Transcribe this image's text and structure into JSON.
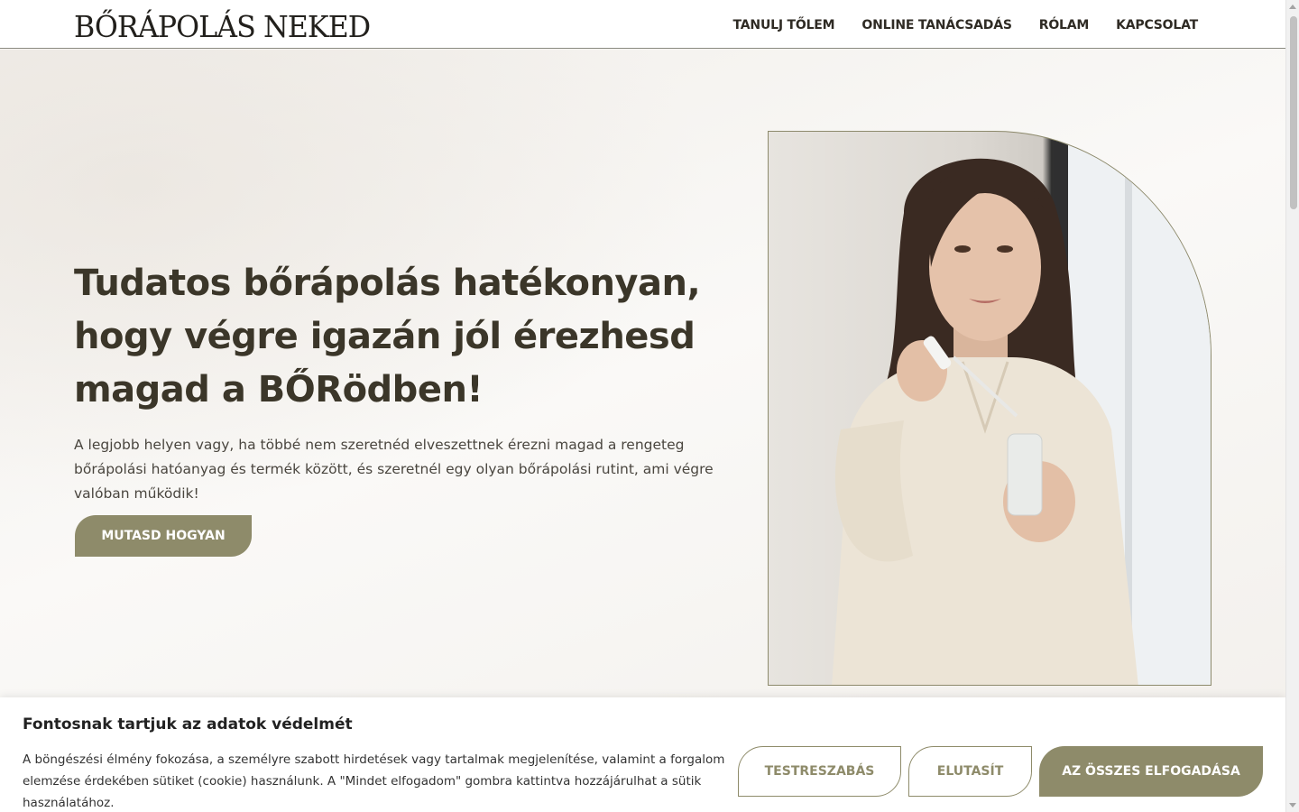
{
  "header": {
    "logo": "BŐRÁPOLÁS NEKED",
    "nav": [
      {
        "label": "TANULJ TŐLEM"
      },
      {
        "label": "ONLINE TANÁCSADÁS"
      },
      {
        "label": "RÓLAM"
      },
      {
        "label": "KAPCSOLAT"
      }
    ]
  },
  "hero": {
    "title": "Tudatos bőrápolás hatékonyan, hogy végre igazán jól érezhesd magad a BŐRödben!",
    "text": "A legjobb helyen vagy, ha többé nem szeretnéd elveszettnek érezni magad a rengeteg bőrápolási hatóanyag és termék között, és szeretnél egy olyan bőrápolási rutint, ami végre valóban működik!",
    "cta": "MUTASD HOGYAN"
  },
  "cookie": {
    "title": "Fontosnak tartjuk az adatok védelmét",
    "text": "A böngészési élmény fokozása, a személyre szabott hirdetések vagy tartalmak megjelenítése, valamint a forgalom elemzése érdekében sütiket (cookie) használunk. A \"Mindet elfogadom\" gombra kattintva hozzájárulhat a sütik használatához.",
    "customize": "TESTRESZABÁS",
    "reject": "ELUTASÍT",
    "accept": "AZ ÖSSZES ELFOGADÁSA"
  },
  "colors": {
    "accent": "#8e8b6a",
    "heading": "#3b3629",
    "background": "#f6f4f1"
  }
}
